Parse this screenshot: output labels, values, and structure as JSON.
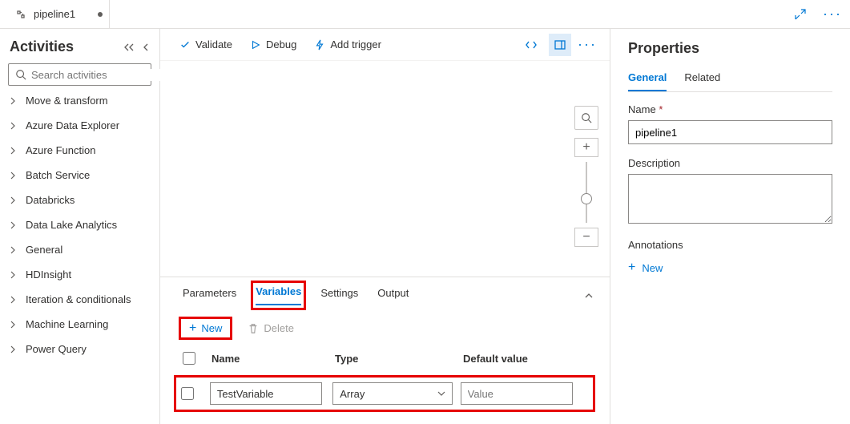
{
  "tab": {
    "title": "pipeline1"
  },
  "tabbar_right": {
    "expand_icon": "expand-icon",
    "more_icon": "more-icon"
  },
  "sidebar": {
    "title": "Activities",
    "search_placeholder": "Search activities",
    "items": [
      "Move & transform",
      "Azure Data Explorer",
      "Azure Function",
      "Batch Service",
      "Databricks",
      "Data Lake Analytics",
      "General",
      "HDInsight",
      "Iteration & conditionals",
      "Machine Learning",
      "Power Query"
    ]
  },
  "toolbar": {
    "validate": "Validate",
    "debug": "Debug",
    "add_trigger": "Add trigger"
  },
  "bottom_panel": {
    "tabs": {
      "parameters": "Parameters",
      "variables": "Variables",
      "settings": "Settings",
      "output": "Output"
    },
    "new_label": "New",
    "delete_label": "Delete",
    "headers": {
      "name": "Name",
      "type": "Type",
      "default": "Default value"
    },
    "row": {
      "name": "TestVariable",
      "type": "Array",
      "default_placeholder": "Value"
    }
  },
  "properties": {
    "title": "Properties",
    "tabs": {
      "general": "General",
      "related": "Related"
    },
    "name_label": "Name",
    "name_value": "pipeline1",
    "description_label": "Description",
    "annotations_label": "Annotations",
    "new_label": "New"
  }
}
